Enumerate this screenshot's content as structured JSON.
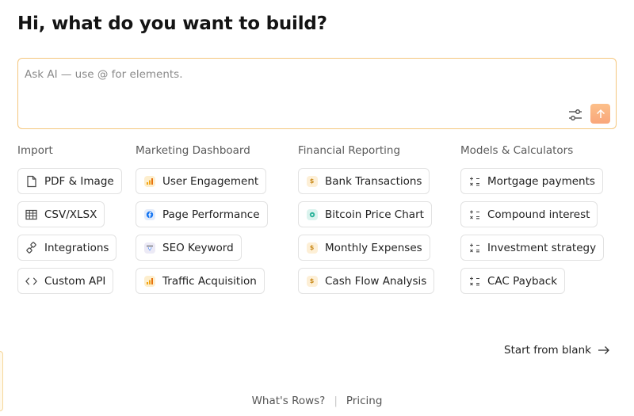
{
  "heading": "Hi, what do you want to build?",
  "prompt": {
    "placeholder": "Ask AI — use @ for elements.",
    "value": ""
  },
  "columns": [
    {
      "title": "Import",
      "items": [
        {
          "label": "PDF & Image",
          "icon": "file-icon"
        },
        {
          "label": "CSV/XLSX",
          "icon": "table-icon"
        },
        {
          "label": "Integrations",
          "icon": "plug-icon"
        },
        {
          "label": "Custom API",
          "icon": "code-icon"
        }
      ]
    },
    {
      "title": "Marketing Dashboard",
      "items": [
        {
          "label": "User Engagement",
          "icon": "analytics-icon"
        },
        {
          "label": "Page Performance",
          "icon": "facebook-icon"
        },
        {
          "label": "SEO Keyword",
          "icon": "search-console-icon"
        },
        {
          "label": "Traffic Acquisition",
          "icon": "analytics-icon"
        }
      ]
    },
    {
      "title": "Financial Reporting",
      "items": [
        {
          "label": "Bank Transactions",
          "icon": "dollar-icon"
        },
        {
          "label": "Bitcoin Price Chart",
          "icon": "bitcoin-icon"
        },
        {
          "label": "Monthly Expenses",
          "icon": "dollar-icon"
        },
        {
          "label": "Cash Flow Analysis",
          "icon": "dollar-icon"
        }
      ]
    },
    {
      "title": "Models & Calculators",
      "items": [
        {
          "label": "Mortgage payments",
          "icon": "calculator-icon"
        },
        {
          "label": "Compound interest",
          "icon": "calculator-icon"
        },
        {
          "label": "Investment strategy",
          "icon": "calculator-icon"
        },
        {
          "label": "CAC Payback",
          "icon": "calculator-icon"
        }
      ]
    }
  ],
  "start_blank": "Start from blank",
  "footer": {
    "whats_rows": "What's Rows?",
    "pricing": "Pricing"
  },
  "colors": {
    "accent_border": "#f5c77e",
    "send_button": "#f9a67a"
  }
}
